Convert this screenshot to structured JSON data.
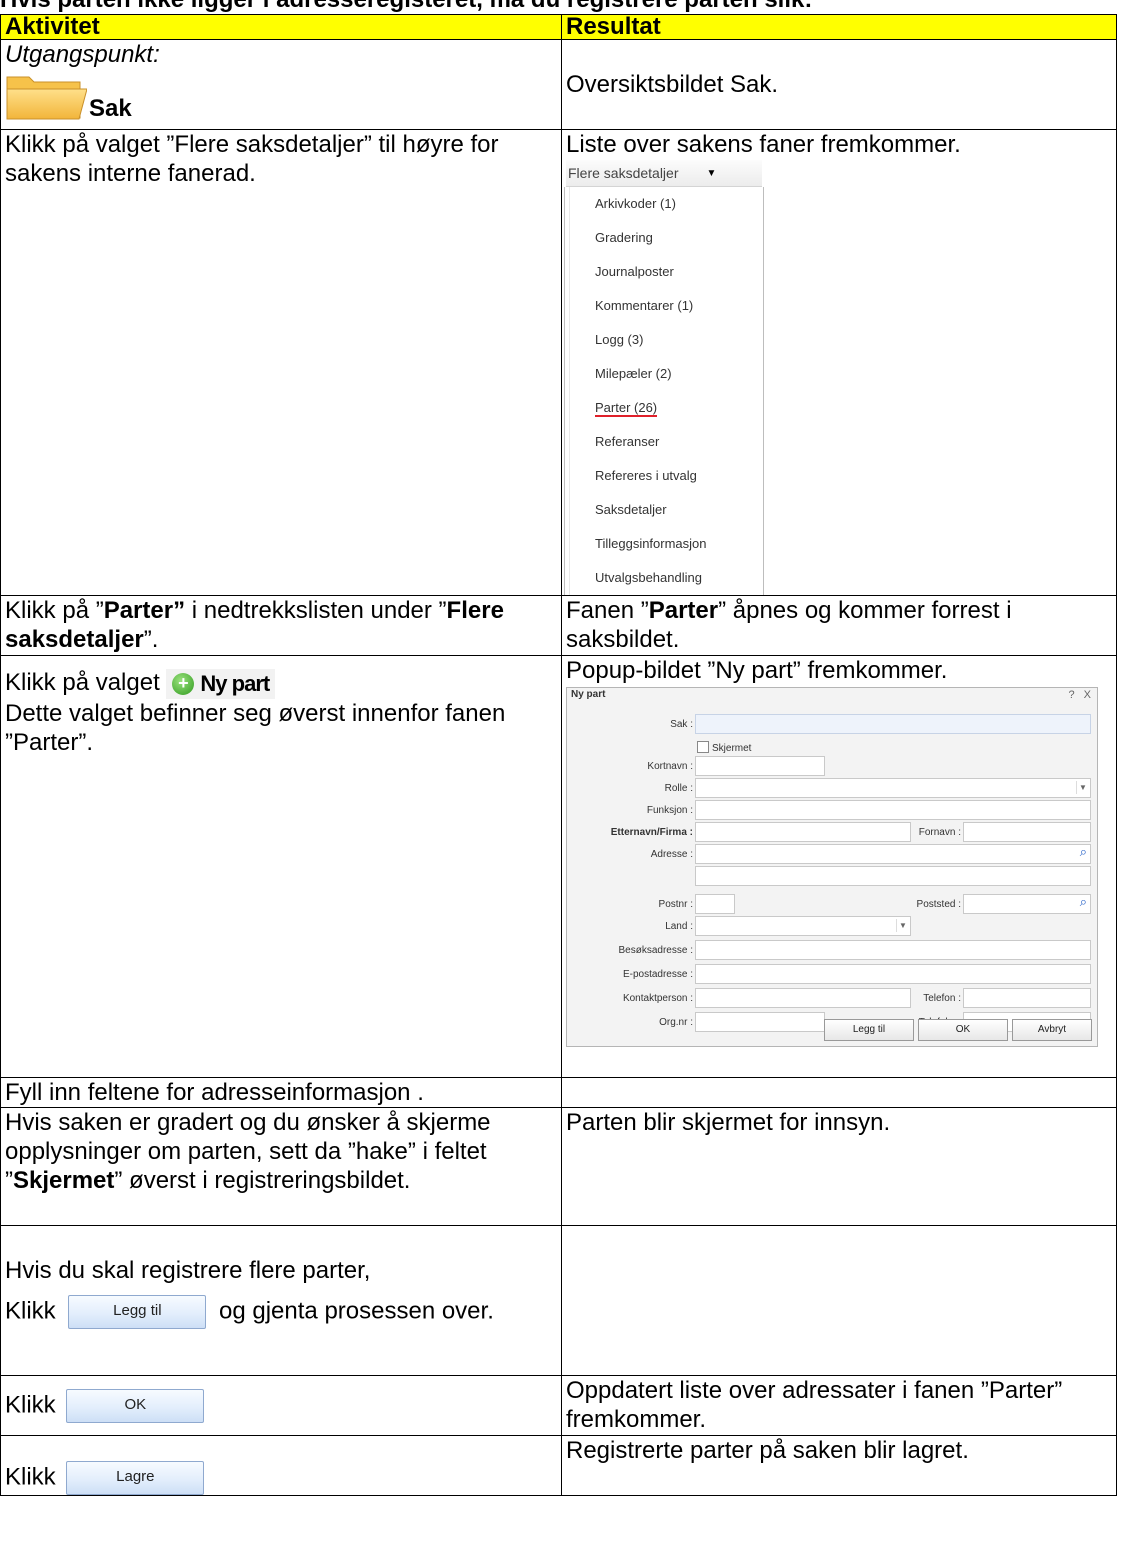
{
  "heading": "Hvis parten ikke ligger i adresseregisteret, må du registrere parten slik:",
  "headers": {
    "activity": "Aktivitet",
    "result": "Resultat"
  },
  "rows": {
    "r1": {
      "activity_intro": "Utgangspunkt:",
      "activity_label": "Sak",
      "result": "Oversiktsbildet Sak."
    },
    "r2": {
      "activity": "Klikk på valget ”Flere saksdetaljer” til høyre for sakens interne fanerad.",
      "result": "Liste over sakens faner fremkommer."
    },
    "r3": {
      "a1": "Klikk på ”",
      "a2": "Parter”",
      "a3": " i nedtrekkslisten under ”",
      "a4": "Flere saksdetaljer",
      "a5": "”.",
      "r1": "Fanen ”",
      "r2": "Parter",
      "r3": "” åpnes og kommer forrest i saksbildet."
    },
    "r4": {
      "a1": "Klikk på valget",
      "button": "Ny part",
      "a2": "Dette valget befinner seg øverst innenfor fanen ”Parter”.",
      "result": "Popup-bildet ”Ny part” fremkommer."
    },
    "r5": {
      "activity": "Fyll inn feltene for adresseinformasjon ."
    },
    "r6": {
      "a1": "Hvis saken er gradert og du ønsker å skjerme opplysninger om parten, sett da ”hake” i feltet ”",
      "a2": "Skjermet",
      "a3": "” øverst i registreringsbildet.",
      "result": "Parten blir skjermet for innsyn."
    },
    "r7": {
      "a1": "Hvis du skal registrere flere parter,",
      "a2": "Klikk",
      "button": "Legg til",
      "a3": "og gjenta prosessen over."
    },
    "r8": {
      "a1": "Klikk",
      "button": "OK",
      "result": "Oppdatert liste over adressater i fanen ”Parter” fremkommer."
    },
    "r9": {
      "a1": "Klikk",
      "button": "Lagre",
      "result": "Registrerte parter på saken blir lagret."
    }
  },
  "dropdown": {
    "header": "Flere saksdetaljer",
    "items": [
      "Arkivkoder (1)",
      "Gradering",
      "Journalposter",
      "Kommentarer (1)",
      "Logg (3)",
      "Milepæler (2)",
      "Parter (26)",
      "Referanser",
      "Refereres i utvalg",
      "Saksdetaljer",
      "Tilleggsinformasjon",
      "Utvalgsbehandling"
    ],
    "highlighted": "Parter (26)"
  },
  "popup": {
    "title": "Ny part",
    "controls": "? X",
    "labels": {
      "sak": "Sak :",
      "skjermet": "Skjermet",
      "kortnavn": "Kortnavn :",
      "rolle": "Rolle :",
      "funksjon": "Funksjon :",
      "etternavn": "Etternavn/Firma :",
      "fornavn": "Fornavn :",
      "adresse": "Adresse :",
      "postnr": "Postnr :",
      "poststed": "Poststed :",
      "land": "Land :",
      "besoksadresse": "Besøksadresse :",
      "epost": "E-postadresse :",
      "kontaktperson": "Kontaktperson :",
      "telefon": "Telefon :",
      "orgnr": "Org.nr :",
      "telefaks": "Telefaks :"
    },
    "buttons": {
      "legg_til": "Legg til",
      "ok": "OK",
      "avbryt": "Avbryt"
    }
  }
}
